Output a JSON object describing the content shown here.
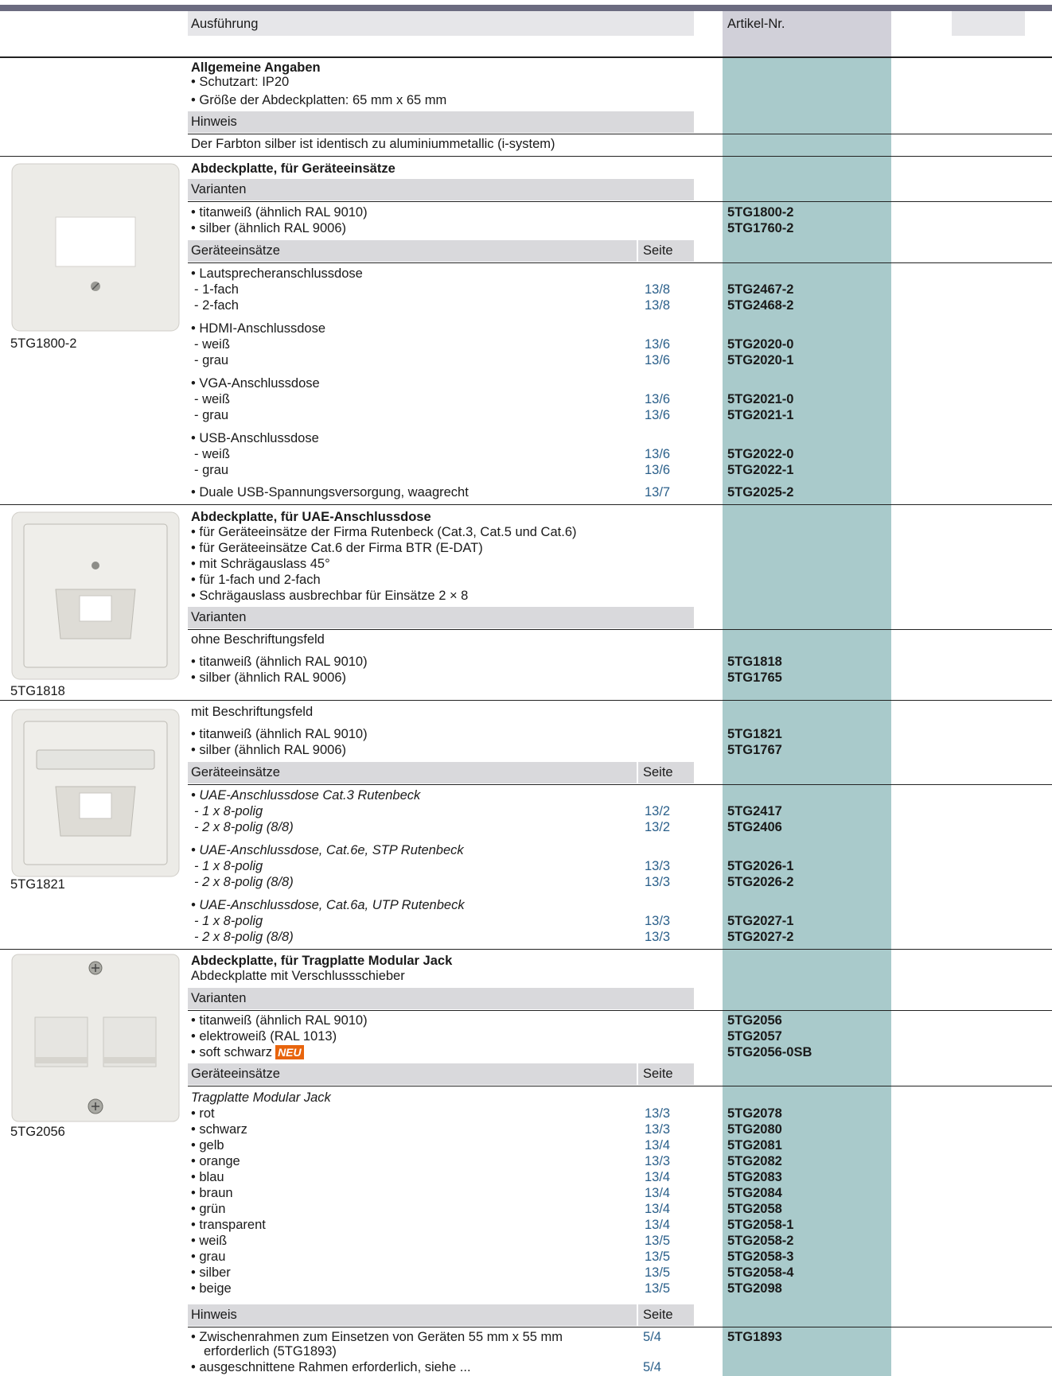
{
  "header": {
    "col_ausfuehrung": "Ausführung",
    "col_artikel": "Artikel-Nr."
  },
  "general": {
    "title": "Allgemeine Angaben",
    "bullets": [
      "• Schutzart: IP20",
      "• Größe der Abdeckplatten: 65 mm x 65 mm"
    ],
    "hinweis_label": "Hinweis",
    "hinweis_text": "Der Farbton silber ist identisch zu aluminiummetallic (i-system)"
  },
  "sec1": {
    "image_label": "5TG1800-2",
    "title": "Abdeckplatte, für Geräteeinsätze",
    "varianten_label": "Varianten",
    "variants": [
      {
        "text": "• titanweiß (ähnlich RAL 9010)",
        "art": "5TG1800-2"
      },
      {
        "text": "• silber (ähnlich RAL 9006)",
        "art": "5TG1760-2"
      }
    ],
    "einsaetze_label": "Geräteeinsätze",
    "seite_label": "Seite",
    "groups": [
      {
        "head": "• Lautsprecheranschlussdose",
        "rows": [
          {
            "text": "- 1-fach",
            "seite": "13/8",
            "art": "5TG2467-2"
          },
          {
            "text": "- 2-fach",
            "seite": "13/8",
            "art": "5TG2468-2"
          }
        ]
      },
      {
        "head": "• HDMI-Anschlussdose",
        "rows": [
          {
            "text": "- weiß",
            "seite": "13/6",
            "art": "5TG2020-0"
          },
          {
            "text": "- grau",
            "seite": "13/6",
            "art": "5TG2020-1"
          }
        ]
      },
      {
        "head": "• VGA-Anschlussdose",
        "rows": [
          {
            "text": "- weiß",
            "seite": "13/6",
            "art": "5TG2021-0"
          },
          {
            "text": "- grau",
            "seite": "13/6",
            "art": "5TG2021-1"
          }
        ]
      },
      {
        "head": "• USB-Anschlussdose",
        "rows": [
          {
            "text": "- weiß",
            "seite": "13/6",
            "art": "5TG2022-0"
          },
          {
            "text": "- grau",
            "seite": "13/6",
            "art": "5TG2022-1"
          }
        ]
      }
    ],
    "last": {
      "text": "• Duale USB-Spannungsversorgung, waagrecht",
      "seite": "13/7",
      "art": "5TG2025-2"
    }
  },
  "sec2": {
    "image_label": "5TG1818",
    "title": "Abdeckplatte, für UAE-Anschlussdose",
    "bullets": [
      "• für Geräteeinsätze der Firma Rutenbeck (Cat.3, Cat.5 und Cat.6)",
      "• für Geräteeinsätze Cat.6 der Firma BTR (E-DAT)",
      "• mit Schrägauslass 45°",
      "• für 1-fach und 2-fach",
      "• Schrägauslass ausbrechbar für Einsätze 2 × 8"
    ],
    "varianten_label": "Varianten",
    "sub1": "ohne Beschriftungsfeld",
    "variants1": [
      {
        "text": "• titanweiß (ähnlich RAL 9010)",
        "art": "5TG1818"
      },
      {
        "text": "• silber (ähnlich RAL 9006)",
        "art": "5TG1765"
      }
    ]
  },
  "sec3": {
    "image_label": "5TG1821",
    "sub2": "mit Beschriftungsfeld",
    "variants2": [
      {
        "text": "• titanweiß (ähnlich RAL 9010)",
        "art": "5TG1821"
      },
      {
        "text": "• silber (ähnlich RAL 9006)",
        "art": "5TG1767"
      }
    ],
    "einsaetze_label": "Geräteeinsätze",
    "seite_label": "Seite",
    "groups": [
      {
        "head": "• UAE-Anschlussdose Cat.3 Rutenbeck",
        "rows": [
          {
            "text": "- 1 x 8-polig",
            "seite": "13/2",
            "art": "5TG2417"
          },
          {
            "text": "- 2 x 8-polig (8/8)",
            "seite": "13/2",
            "art": "5TG2406"
          }
        ]
      },
      {
        "head": "• UAE-Anschlussdose, Cat.6e, STP Rutenbeck",
        "rows": [
          {
            "text": "- 1 x 8-polig",
            "seite": "13/3",
            "art": "5TG2026-1"
          },
          {
            "text": "- 2 x 8-polig (8/8)",
            "seite": "13/3",
            "art": "5TG2026-2"
          }
        ]
      },
      {
        "head": "• UAE-Anschlussdose, Cat.6a, UTP Rutenbeck",
        "rows": [
          {
            "text": "- 1 x 8-polig",
            "seite": "13/3",
            "art": "5TG2027-1"
          },
          {
            "text": "- 2 x 8-polig (8/8)",
            "seite": "13/3",
            "art": "5TG2027-2"
          }
        ]
      }
    ]
  },
  "sec4": {
    "image_label": "5TG2056",
    "title": "Abdeckplatte, für Tragplatte Modular Jack",
    "subtitle": "Abdeckplatte mit Verschlussschieber",
    "varianten_label": "Varianten",
    "variants": [
      {
        "text": "• titanweiß (ähnlich RAL 9010)",
        "art": "5TG2056"
      },
      {
        "text": "• elektroweiß (RAL 1013)",
        "art": "5TG2057"
      },
      {
        "text": "• soft schwarz",
        "art": "5TG2056-0SB",
        "badge": "NEU"
      }
    ],
    "einsaetze_label": "Geräteeinsätze",
    "seite_label": "Seite",
    "group_head": "Tragplatte Modular Jack",
    "rows": [
      {
        "text": "• rot",
        "seite": "13/3",
        "art": "5TG2078"
      },
      {
        "text": "• schwarz",
        "seite": "13/3",
        "art": "5TG2080"
      },
      {
        "text": "• gelb",
        "seite": "13/4",
        "art": "5TG2081"
      },
      {
        "text": "• orange",
        "seite": "13/3",
        "art": "5TG2082"
      },
      {
        "text": "• blau",
        "seite": "13/4",
        "art": "5TG2083"
      },
      {
        "text": "• braun",
        "seite": "13/4",
        "art": "5TG2084"
      },
      {
        "text": "• grün",
        "seite": "13/4",
        "art": "5TG2058"
      },
      {
        "text": "• transparent",
        "seite": "13/4",
        "art": "5TG2058-1"
      },
      {
        "text": "• weiß",
        "seite": "13/5",
        "art": "5TG2058-2"
      },
      {
        "text": "• grau",
        "seite": "13/5",
        "art": "5TG2058-3"
      },
      {
        "text": "• silber",
        "seite": "13/5",
        "art": "5TG2058-4"
      },
      {
        "text": "• beige",
        "seite": "13/5",
        "art": "5TG2098"
      }
    ],
    "hinweis_label": "Hinweis",
    "hinweis_seite_label": "Seite",
    "notes": [
      {
        "line1": "• Zwischenrahmen zum Einsetzen von Geräten 55 mm x 55 mm",
        "line2": "erforderlich (5TG1893)",
        "seite": "5/4",
        "art": "5TG1893"
      },
      {
        "line1": "• ausgeschnittene Rahmen erforderlich, siehe ...",
        "seite": "5/4"
      }
    ]
  },
  "colors": {
    "teal_column": "#a9cacb",
    "header_gray": "#d9d9dc",
    "link_blue": "#2a5f8a",
    "badge_orange": "#e8640c"
  }
}
